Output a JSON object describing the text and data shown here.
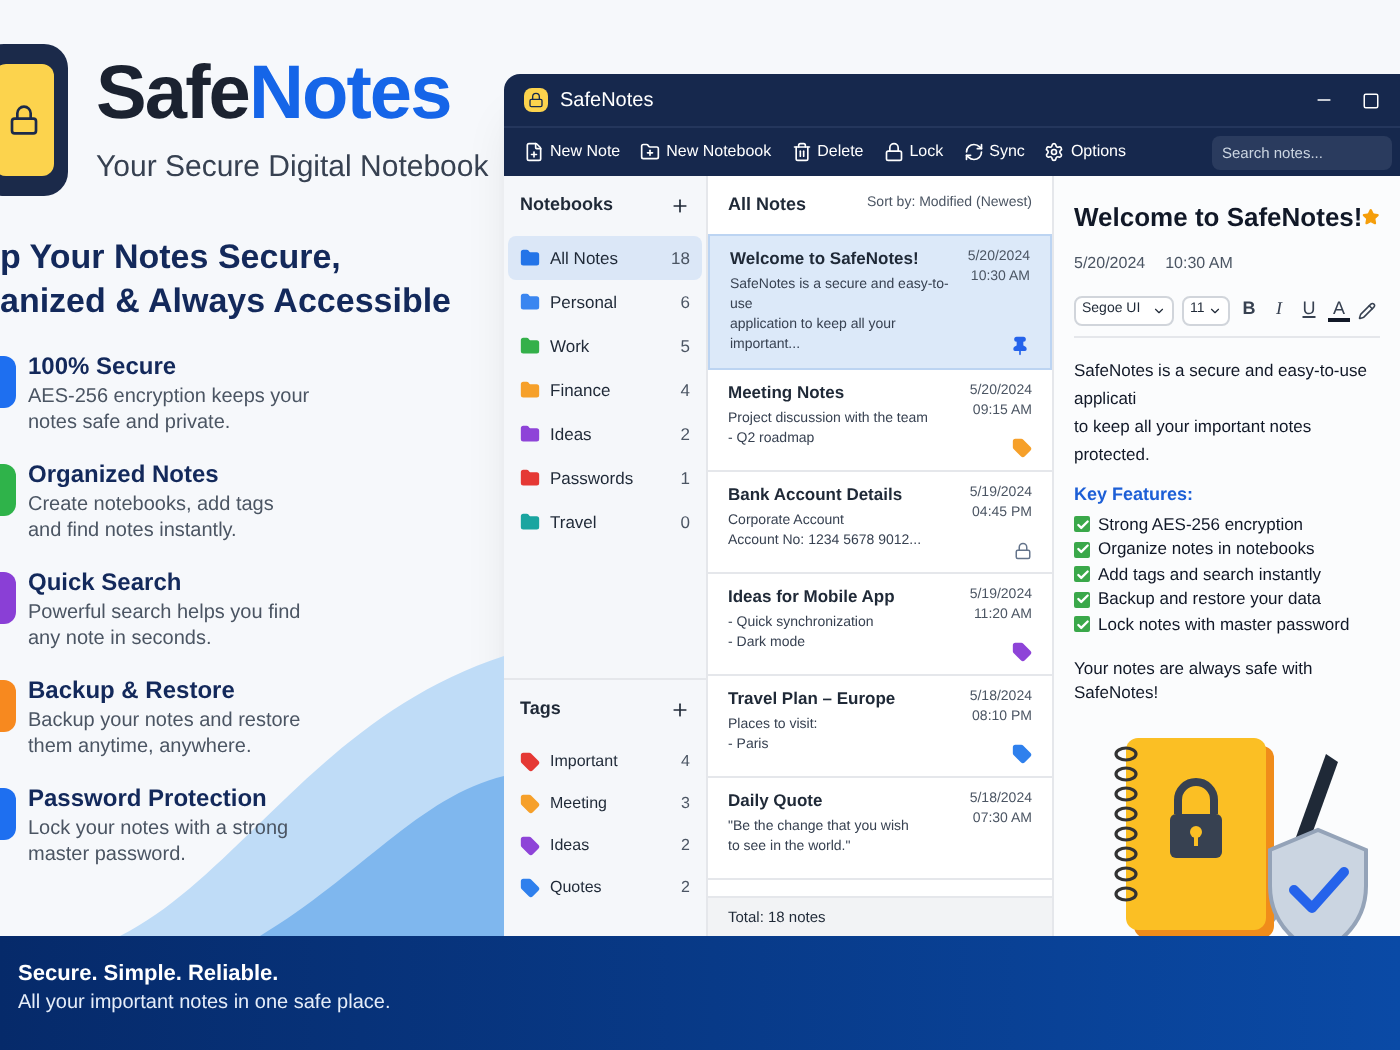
{
  "hero": {
    "brand_parts": [
      "Safe",
      "Notes"
    ],
    "tagline": "Your Secure Digital Notebook",
    "headline": [
      "p Your Notes Secure,",
      "anized & Always Accessible"
    ]
  },
  "features": [
    {
      "title": "100% Secure",
      "description": "AES-256 encryption keeps your notes safe and private.",
      "color": "#1e6ff0"
    },
    {
      "title": "Organized Notes",
      "description": "Create notebooks, add tags and find notes instantly.",
      "color": "#2fb34a"
    },
    {
      "title": "Quick Search",
      "description": "Powerful search helps you find any note in seconds.",
      "color": "#8a3fd6"
    },
    {
      "title": "Backup & Restore",
      "description": "Backup your notes and restore them anytime, anywhere.",
      "color": "#f7891f"
    },
    {
      "title": "Password Protection",
      "description": "Lock your notes with a strong master password.",
      "color": "#1e6ff0"
    }
  ],
  "window": {
    "title": "SafeNotes"
  },
  "toolbar": [
    {
      "label": "New Note",
      "kind": "new-note"
    },
    {
      "label": "New Notebook",
      "kind": "new-notebook"
    },
    {
      "label": "Delete",
      "kind": "delete"
    },
    {
      "label": "Lock",
      "kind": "lock"
    },
    {
      "label": "Sync",
      "kind": "sync"
    },
    {
      "label": "Options",
      "kind": "options"
    }
  ],
  "search": {
    "placeholder": "Search notes..."
  },
  "notebooks": {
    "title": "Notebooks",
    "items": [
      {
        "name": "All Notes",
        "count": "18",
        "color": "#2374e8",
        "selected": true
      },
      {
        "name": "Personal",
        "count": "6",
        "color": "#3a86f0",
        "selected": false
      },
      {
        "name": "Work",
        "count": "5",
        "color": "#34b04a",
        "selected": false
      },
      {
        "name": "Finance",
        "count": "4",
        "color": "#f6a02a",
        "selected": false
      },
      {
        "name": "Ideas",
        "count": "2",
        "color": "#8e44d8",
        "selected": false
      },
      {
        "name": "Passwords",
        "count": "1",
        "color": "#e53935",
        "selected": false
      },
      {
        "name": "Travel",
        "count": "0",
        "color": "#1aa5a0",
        "selected": false
      }
    ]
  },
  "tags": {
    "title": "Tags",
    "items": [
      {
        "name": "Important",
        "count": "4",
        "color": "#e53935"
      },
      {
        "name": "Meeting",
        "count": "3",
        "color": "#f6a02a"
      },
      {
        "name": "Ideas",
        "count": "2",
        "color": "#8e44d8"
      },
      {
        "name": "Quotes",
        "count": "2",
        "color": "#2f80ed"
      }
    ]
  },
  "note_list": {
    "title": "All Notes",
    "sort": "Sort by: Modified (Newest)",
    "total": "Total: 18 notes",
    "notes": [
      {
        "title": "Welcome to SafeNotes!",
        "preview": [
          "SafeNotes is a secure and easy-to-use",
          "application to keep all your important..."
        ],
        "date": "5/20/2024",
        "time": "10:30 AM",
        "selected": true,
        "marker": {
          "kind": "pin"
        }
      },
      {
        "title": "Meeting Notes",
        "preview": [
          "Project discussion with the team",
          "- Q2 roadmap"
        ],
        "date": "5/20/2024",
        "time": "09:15 AM",
        "selected": false,
        "marker": {
          "kind": "tag",
          "color": "#f6a02a"
        }
      },
      {
        "title": "Bank Account Details",
        "preview": [
          "Corporate Account",
          "Account No: 1234 5678 9012..."
        ],
        "date": "5/19/2024",
        "time": "04:45 PM",
        "selected": false,
        "marker": {
          "kind": "lock"
        }
      },
      {
        "title": "Ideas for Mobile App",
        "preview": [
          "- Quick synchronization",
          "- Dark mode"
        ],
        "date": "5/19/2024",
        "time": "11:20 AM",
        "selected": false,
        "marker": {
          "kind": "tag",
          "color": "#8e44d8"
        }
      },
      {
        "title": "Travel Plan – Europe",
        "preview": [
          "Places to visit:",
          "- Paris"
        ],
        "date": "5/18/2024",
        "time": "08:10 PM",
        "selected": false,
        "marker": {
          "kind": "tag",
          "color": "#2f80ed"
        }
      },
      {
        "title": "Daily Quote",
        "preview": [
          "\"Be the change that you wish",
          "to see in the world.\""
        ],
        "date": "5/18/2024",
        "time": "07:30 AM",
        "selected": false
      }
    ]
  },
  "editor": {
    "title": "Welcome to SafeNotes!",
    "starred": true,
    "date": "5/20/2024",
    "time": "10:30 AM",
    "font": "Segoe UI",
    "size": "11",
    "format_buttons": [
      "B",
      "I",
      "U",
      "A"
    ],
    "body": [
      "SafeNotes is a secure and easy-to-use applicati",
      "to keep all your important notes protected."
    ],
    "section_title": "Key Features:",
    "checklist": [
      {
        "text": "Strong AES-256 encryption",
        "checked": true
      },
      {
        "text": "Organize notes in notebooks",
        "checked": true
      },
      {
        "text": "Add tags and search instantly",
        "checked": true
      },
      {
        "text": "Backup and restore your data",
        "checked": true
      },
      {
        "text": "Lock notes with master password",
        "checked": true
      }
    ],
    "closing": "Your notes are always safe with SafeNotes!"
  },
  "footer": {
    "slogan": "Secure. Simple. Reliable.",
    "subtitle": "All your important notes in one safe place."
  }
}
